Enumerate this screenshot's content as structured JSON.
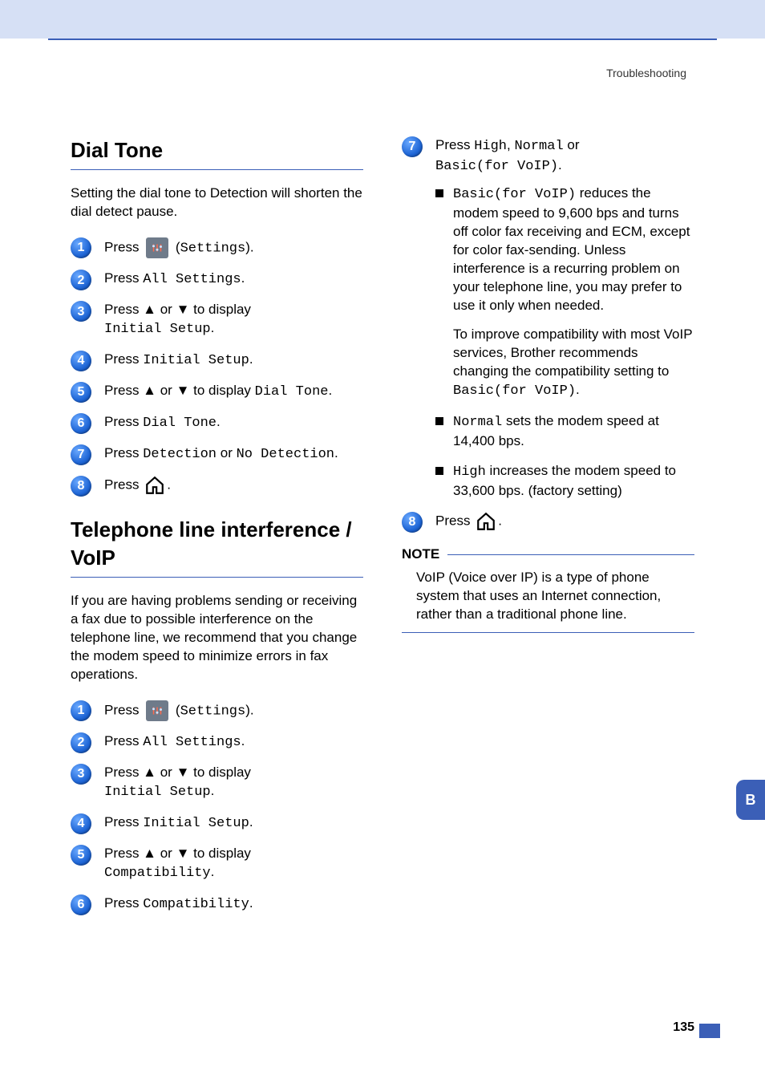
{
  "header": {
    "label": "Troubleshooting"
  },
  "sideTab": "B",
  "pageNumber": "135",
  "left": {
    "section1": {
      "title": "Dial Tone",
      "intro": "Setting the dial tone to Detection will shorten the dial detect pause.",
      "steps": {
        "s1_a": "Press ",
        "s1_b": " (",
        "s1_c": "Settings",
        "s1_d": ").",
        "s2_a": "Press ",
        "s2_b": "All Settings",
        "s2_c": ".",
        "s3_a": "Press ▲ or ▼ to display ",
        "s3_b": "Initial Setup",
        "s3_c": ".",
        "s4_a": "Press ",
        "s4_b": "Initial Setup",
        "s4_c": ".",
        "s5_a": "Press ▲ or ▼ to display ",
        "s5_b": "Dial Tone",
        "s5_c": ".",
        "s6_a": "Press ",
        "s6_b": "Dial Tone",
        "s6_c": ".",
        "s7_a": "Press ",
        "s7_b": "Detection",
        "s7_c": " or ",
        "s7_d": "No Detection",
        "s7_e": ".",
        "s8_a": "Press ",
        "s8_b": "."
      }
    },
    "section2": {
      "title": "Telephone line interference / VoIP",
      "intro": "If you are having problems sending or receiving a fax due to possible interference on the telephone line, we recommend that you change the modem speed to minimize errors in fax operations.",
      "steps": {
        "s1_a": "Press ",
        "s1_b": " (",
        "s1_c": "Settings",
        "s1_d": ").",
        "s2_a": "Press ",
        "s2_b": "All Settings",
        "s2_c": ".",
        "s3_a": "Press ▲ or ▼ to display ",
        "s3_b": "Initial Setup",
        "s3_c": ".",
        "s4_a": "Press ",
        "s4_b": "Initial Setup",
        "s4_c": ".",
        "s5_a": "Press ▲ or ▼ to display ",
        "s5_b": "Compatibility",
        "s5_c": ".",
        "s6_a": "Press ",
        "s6_b": "Compatibility",
        "s6_c": "."
      }
    }
  },
  "right": {
    "step7": {
      "line_a": "Press ",
      "line_b": "High",
      "line_c": ", ",
      "line_d": "Normal",
      "line_e": " or ",
      "line_f": "Basic(for VoIP)",
      "line_g": ".",
      "bullet1_a": "Basic(for VoIP)",
      "bullet1_b": " reduces the modem speed to 9,600 bps and turns off color fax receiving and ECM, except for color fax-sending. Unless interference is a recurring problem on your telephone line, you may prefer to use it only when needed.",
      "bullet1_p2_a": "To improve compatibility with most VoIP services, Brother recommends changing the compatibility setting to ",
      "bullet1_p2_b": "Basic(for VoIP)",
      "bullet1_p2_c": ".",
      "bullet2_a": "Normal",
      "bullet2_b": " sets the modem speed at 14,400 bps.",
      "bullet3_a": "High",
      "bullet3_b": " increases the modem speed to 33,600 bps. (factory setting)"
    },
    "step8": {
      "a": "Press ",
      "b": "."
    },
    "note": {
      "head": "NOTE",
      "body": "VoIP (Voice over IP) is a type of phone system that uses an Internet connection, rather than a traditional phone line."
    }
  }
}
